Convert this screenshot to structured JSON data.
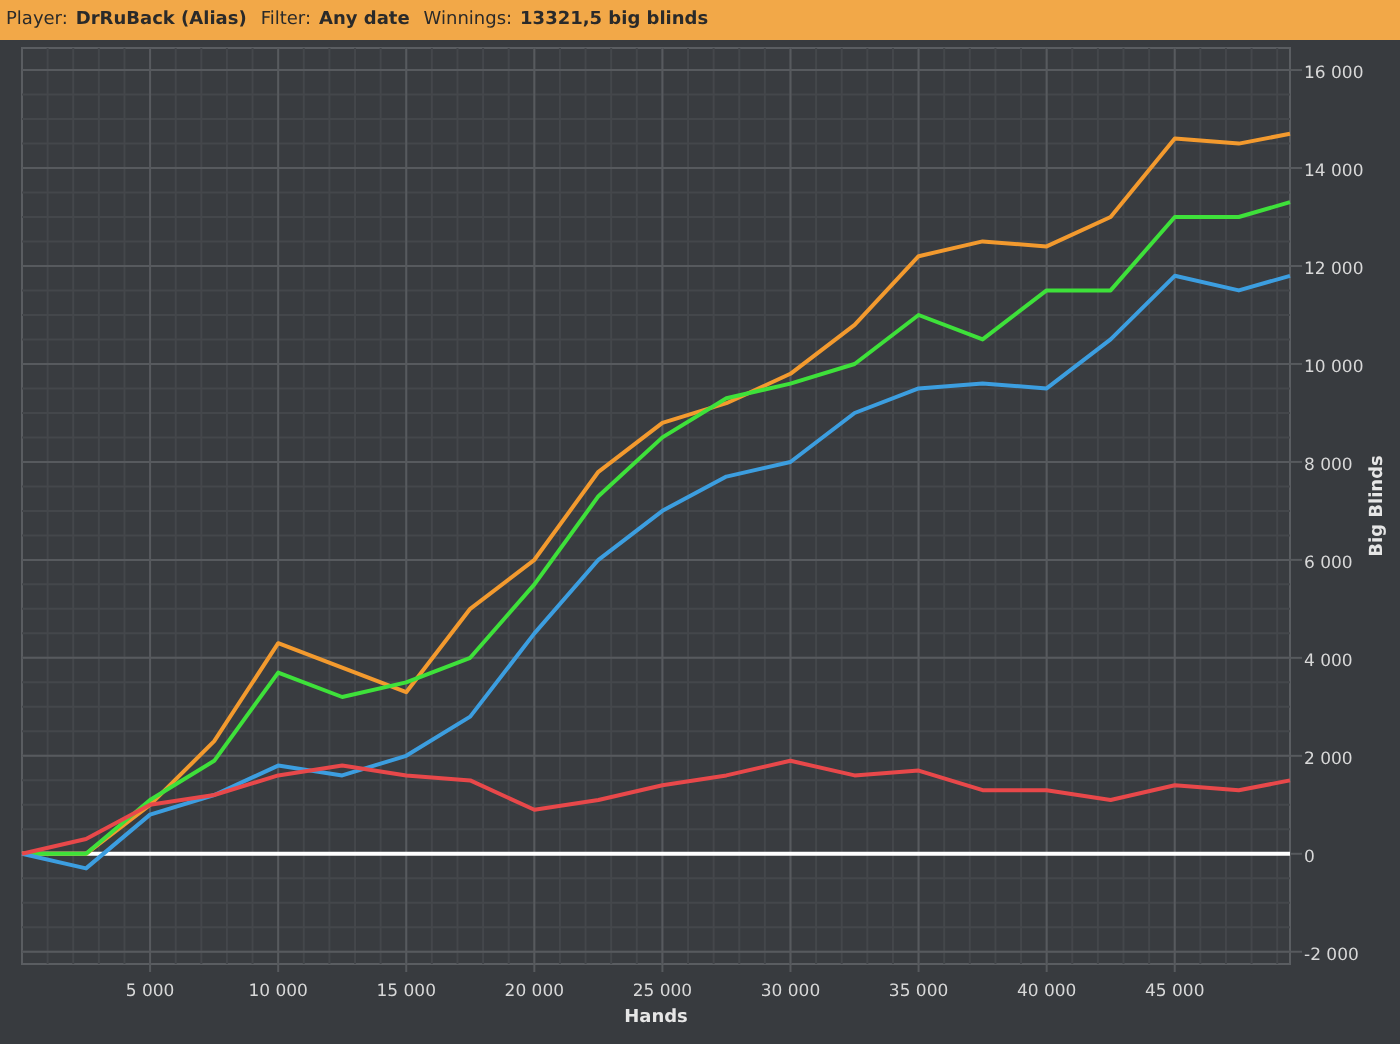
{
  "header": [
    {
      "label": "Player:",
      "value": "DrRuBack (Alias)"
    },
    {
      "label": "Filter:",
      "value": "Any date"
    },
    {
      "label": "Winnings:",
      "value": "13321,5 big blinds"
    }
  ],
  "chart": {
    "chart_data": {
      "type": "line",
      "xlabel": "Hands",
      "ylabel": "Big Blinds",
      "x": [
        0,
        2500,
        5000,
        7500,
        10000,
        12500,
        15000,
        17500,
        20000,
        22500,
        25000,
        27500,
        30000,
        32500,
        35000,
        37500,
        40000,
        42500,
        45000,
        47500,
        49500
      ],
      "series": [
        {
          "color": "#f39a2e",
          "values": [
            0,
            0,
            1000,
            2300,
            4300,
            3800,
            3300,
            5000,
            6000,
            7800,
            8800,
            9200,
            9800,
            10800,
            12200,
            12500,
            12400,
            13000,
            14600,
            14500,
            14700
          ]
        },
        {
          "color": "#3ee13a",
          "values": [
            0,
            0,
            1100,
            1900,
            3700,
            3200,
            3500,
            4000,
            5500,
            7300,
            8500,
            9300,
            9600,
            10000,
            11000,
            10500,
            11500,
            11500,
            13000,
            13000,
            13300
          ]
        },
        {
          "color": "#3c9ee0",
          "values": [
            0,
            -300,
            800,
            1200,
            1800,
            1600,
            2000,
            2800,
            4500,
            6000,
            7000,
            7700,
            8000,
            9000,
            9500,
            9600,
            9500,
            10500,
            11800,
            11500,
            11800
          ]
        },
        {
          "color": "#e8484a",
          "values": [
            0,
            300,
            1000,
            1200,
            1600,
            1800,
            1600,
            1500,
            900,
            1100,
            1400,
            1600,
            1900,
            1600,
            1700,
            1300,
            1300,
            1100,
            1400,
            1300,
            1500
          ]
        }
      ],
      "grid": true,
      "xlim": [
        0,
        49500
      ],
      "ylim": [
        -2250,
        16450
      ],
      "xticks": [
        {
          "value": 5000,
          "label": "5 000"
        },
        {
          "value": 10000,
          "label": "10 000"
        },
        {
          "value": 15000,
          "label": "15 000"
        },
        {
          "value": 20000,
          "label": "20 000"
        },
        {
          "value": 25000,
          "label": "25 000"
        },
        {
          "value": 30000,
          "label": "30 000"
        },
        {
          "value": 35000,
          "label": "35 000"
        },
        {
          "value": 40000,
          "label": "40 000"
        },
        {
          "value": 45000,
          "label": "45 000"
        }
      ],
      "yticks": [
        {
          "value": -2000,
          "label": "-2 000"
        },
        {
          "value": 0,
          "label": "0"
        },
        {
          "value": 2000,
          "label": "2 000"
        },
        {
          "value": 4000,
          "label": "4 000"
        },
        {
          "value": 6000,
          "label": "6 000"
        },
        {
          "value": 8000,
          "label": "8 000"
        },
        {
          "value": 10000,
          "label": "10 000"
        },
        {
          "value": 12000,
          "label": "12 000"
        },
        {
          "value": 14000,
          "label": "14 000"
        },
        {
          "value": 16000,
          "label": "16 000"
        }
      ]
    }
  }
}
